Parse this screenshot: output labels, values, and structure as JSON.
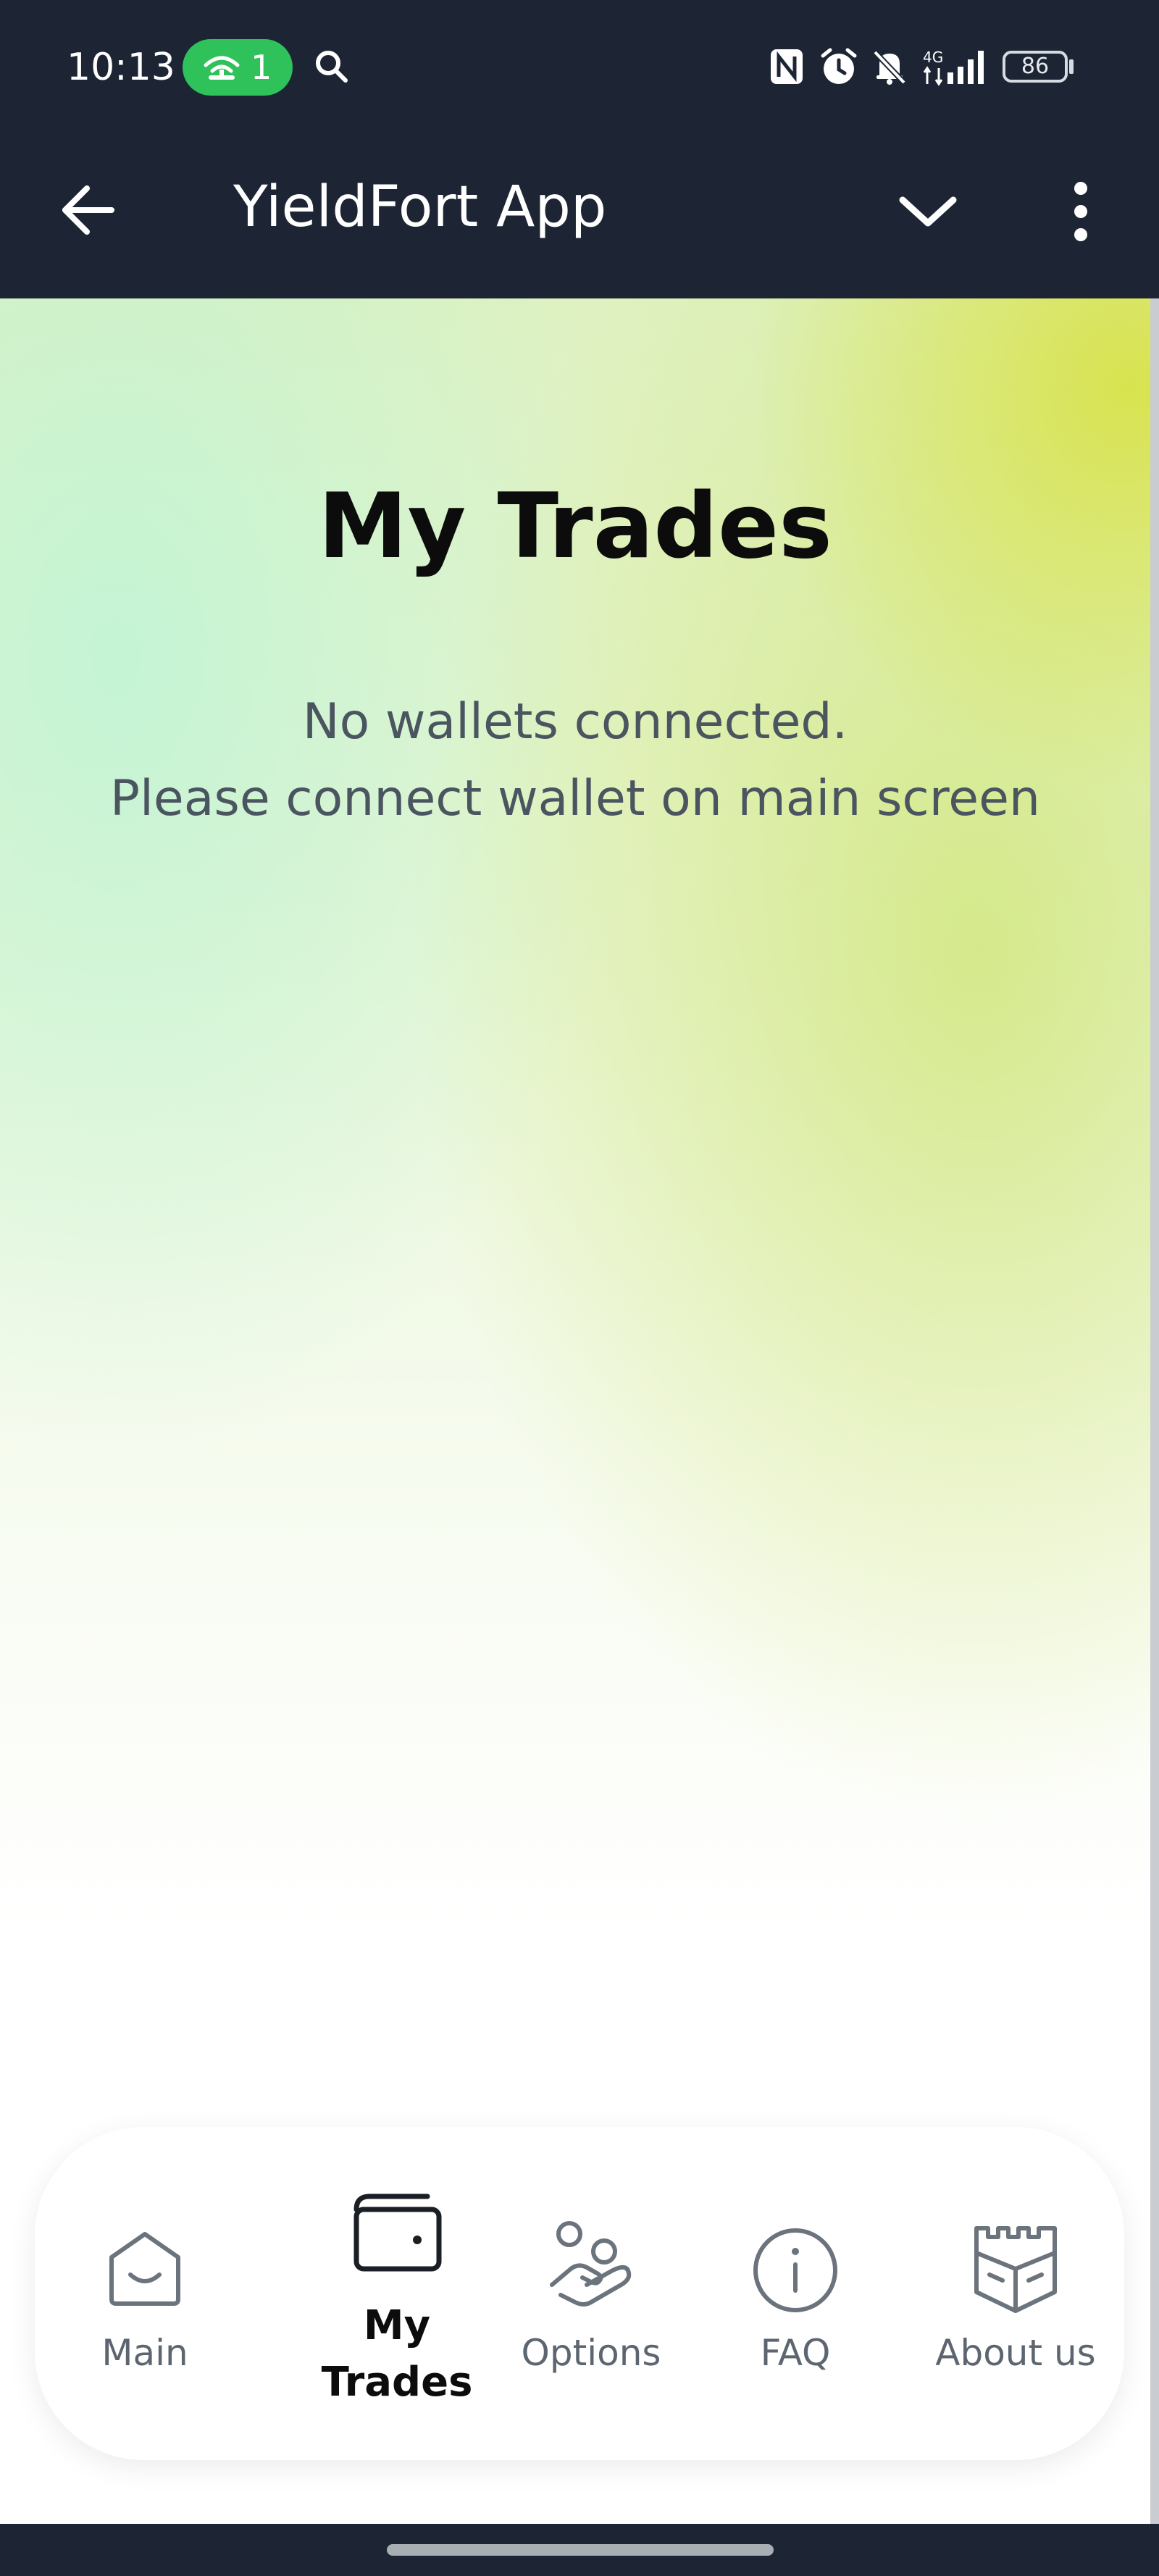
{
  "status_bar": {
    "time": "10:13",
    "hotspot_count": "1",
    "battery": "86",
    "icons": [
      "hotspot-icon",
      "search-icon",
      "nfc-icon",
      "alarm-icon",
      "mute-icon",
      "4g-icon",
      "signal-icon",
      "battery-icon"
    ]
  },
  "app_bar": {
    "title": "YieldFort App",
    "icons": [
      "back-arrow-icon",
      "chevron-down-icon",
      "more-vert-icon"
    ]
  },
  "page": {
    "title": "My Trades",
    "empty_message_line1": "No wallets connected.",
    "empty_message_line2": "Please connect wallet on main screen"
  },
  "nav": {
    "items": [
      {
        "label": "Main",
        "icon": "home-smile-icon",
        "active": false
      },
      {
        "label_line1": "My",
        "label_line2": "Trades",
        "icon": "wallet-icon",
        "active": true
      },
      {
        "label": "Options",
        "icon": "hand-coin-icon",
        "active": false
      },
      {
        "label": "FAQ",
        "icon": "info-icon",
        "active": false
      },
      {
        "label": "About us",
        "icon": "castle-icon",
        "active": false
      }
    ]
  },
  "colors": {
    "header_bg": "#1d2433",
    "hotspot_green": "#2fc15a",
    "title_text": "#0c0c0c",
    "muted_text": "#4a5560",
    "gradient_yellow": "#d8e246",
    "gradient_mint": "#bef4d6"
  }
}
